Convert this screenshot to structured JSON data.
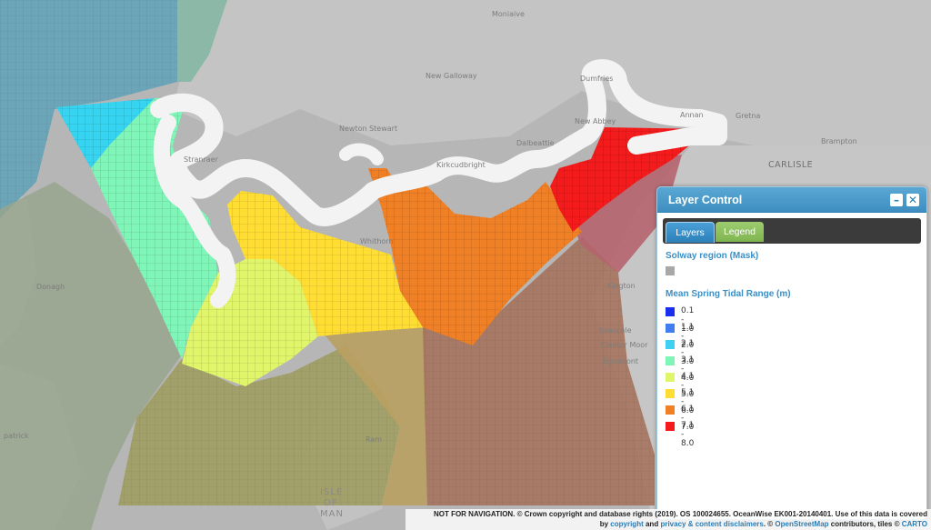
{
  "map": {
    "places": {
      "moniaive": "Moniaive",
      "dumfries": "Dumfries",
      "new_galloway": "New Galloway",
      "new_abbey": "New Abbey",
      "annan": "Annan",
      "gretna": "Gretna",
      "newton_stewart": "Newton Stewart",
      "dalbeattie": "Dalbeattie",
      "brampton": "Brampton",
      "stranraer": "Stranraer",
      "kirkcudbright": "Kirkcudbright",
      "carlisle": "CARLISLE",
      "whithorn": "Whithorn",
      "donaghadee": "Donagh",
      "kington": "Kington",
      "seascale": "Seascale",
      "cleator_moor": "Cleator Moor",
      "egremont": "Egremont",
      "patrick": "patrick",
      "ramsey": "Ram",
      "isle1": "ISLE",
      "isle2": "OF",
      "isle3": "MAN"
    }
  },
  "panel": {
    "title": "Layer Control",
    "minimize": "–",
    "close": "✕",
    "tabs": {
      "layers": "Layers",
      "legend": "Legend"
    },
    "mask_title": "Solway region (Mask)",
    "mask_color": "#a8a8a8",
    "range_title": "Mean Spring Tidal Range (m)",
    "ranges": [
      {
        "label": "0.1 - 1.0",
        "color": "#1a2ef0"
      },
      {
        "label": "1.1 - 2.0",
        "color": "#3f7df0"
      },
      {
        "label": "2.1 - 3.0",
        "color": "#3fd0f3"
      },
      {
        "label": "3.1 - 4.0",
        "color": "#7ff5b8"
      },
      {
        "label": "4.1 - 5.0",
        "color": "#e1f56a"
      },
      {
        "label": "5.1 - 6.0",
        "color": "#ffdd33"
      },
      {
        "label": "6.1 - 7.0",
        "color": "#f08026"
      },
      {
        "label": "7.1 - 8.0",
        "color": "#f31b1b"
      }
    ]
  },
  "attribution": {
    "line1": "NOT FOR NAVIGATION. © Crown copyright and database rights (2019). OS 100024655. OceanWise EK001-20140401. Use of this data is covered",
    "by": "by",
    "copyright": "copyright",
    "and1": "and",
    "privacy": "privacy & content disclaimers",
    "dot": ". ©",
    "osm": "OpenStreetMap",
    "contrib": "contributors, tiles ©",
    "carto": "CARTO"
  }
}
